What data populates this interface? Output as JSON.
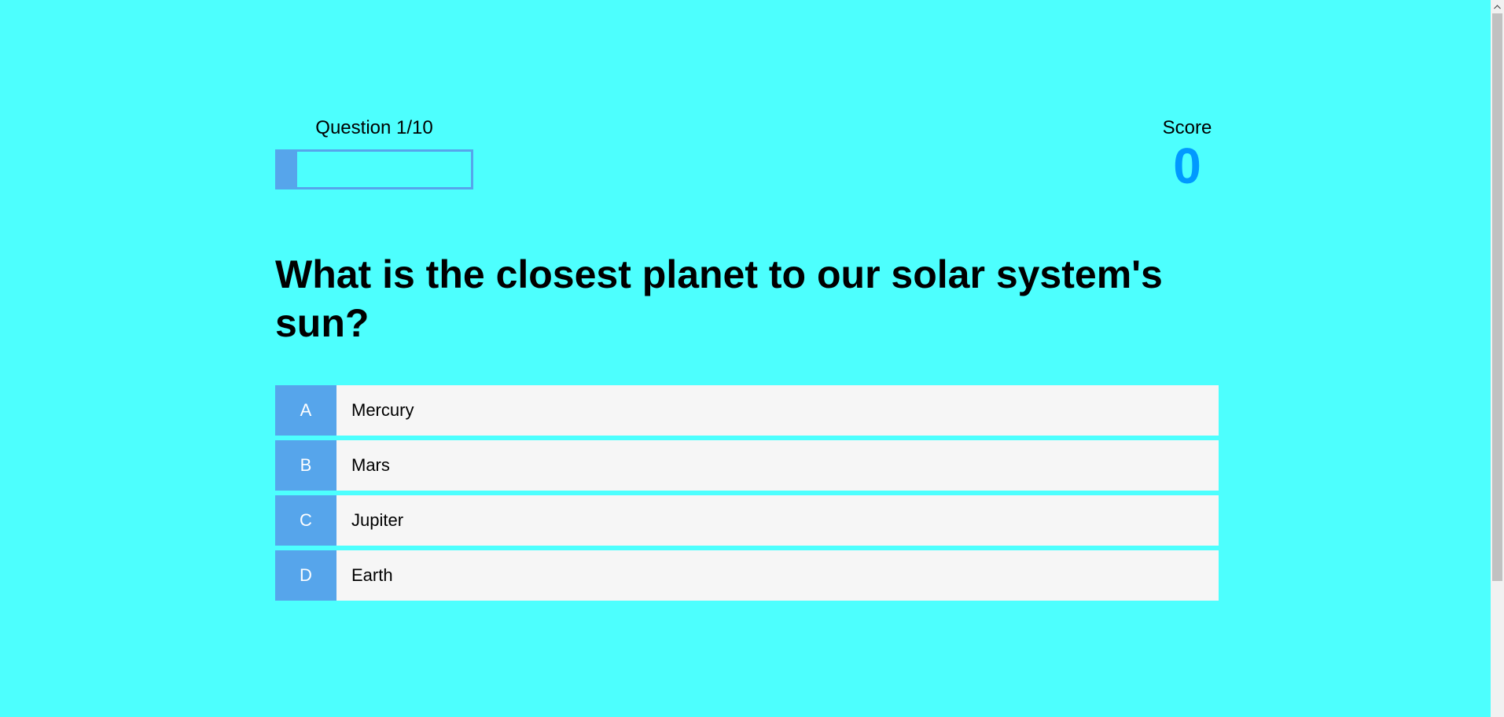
{
  "hud": {
    "progress_text": "Question 1/10",
    "progress_fraction": 0.1,
    "score_label": "Score",
    "score_value": "0"
  },
  "question": "What is the closest planet to our solar system's sun?",
  "choices": [
    {
      "prefix": "A",
      "text": "Mercury"
    },
    {
      "prefix": "B",
      "text": "Mars"
    },
    {
      "prefix": "C",
      "text": "Jupiter"
    },
    {
      "prefix": "D",
      "text": "Earth"
    }
  ],
  "colors": {
    "background": "#4dfffe",
    "accent": "#56a5eb",
    "score": "#0099ff",
    "choice_bg": "#f6f6f6"
  },
  "icons": {
    "scroll_up": "chevron-up-icon"
  }
}
